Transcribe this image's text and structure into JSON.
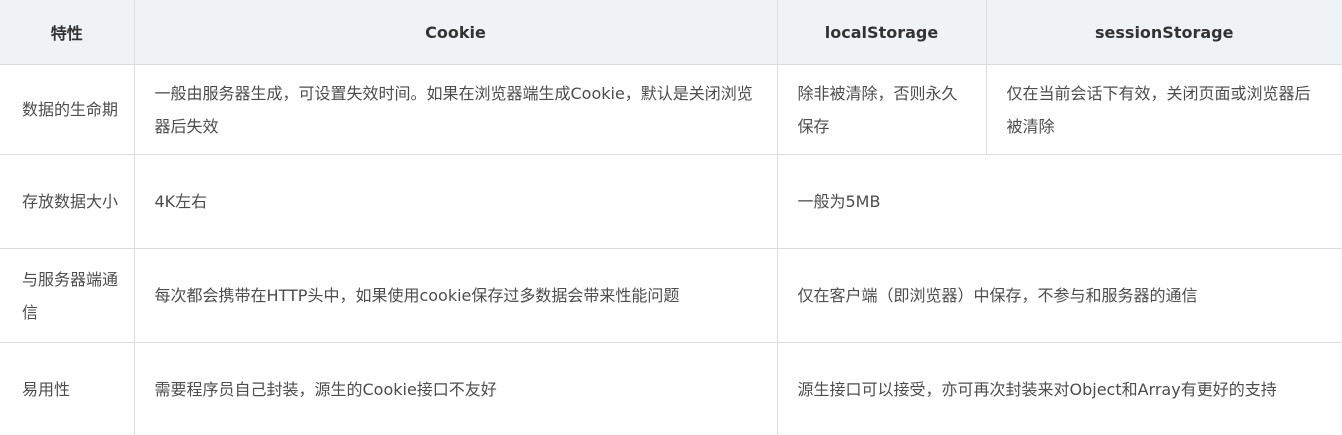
{
  "table": {
    "headers": [
      "特性",
      "Cookie",
      "localStorage",
      "sessionStorage"
    ],
    "rows": [
      {
        "feature": "数据的生命期",
        "cookie": "一般由服务器生成，可设置失效时间。如果在浏览器端生成Cookie，默认是关闭浏览器后失效",
        "local": "除非被清除，否则永久保存",
        "session": "仅在当前会话下有效，关闭页面或浏览器后被清除"
      },
      {
        "feature": "存放数据大小",
        "cookie": "4K左右",
        "shared": "一般为5MB"
      },
      {
        "feature": "与服务器端通信",
        "cookie": "每次都会携带在HTTP头中，如果使用cookie保存过多数据会带来性能问题",
        "shared": "仅在客户端（即浏览器）中保存，不参与和服务器的通信"
      },
      {
        "feature": "易用性",
        "cookie": "需要程序员自己封装，源生的Cookie接口不友好",
        "shared": "源生接口可以接受，亦可再次封装来对Object和Array有更好的支持"
      }
    ]
  }
}
